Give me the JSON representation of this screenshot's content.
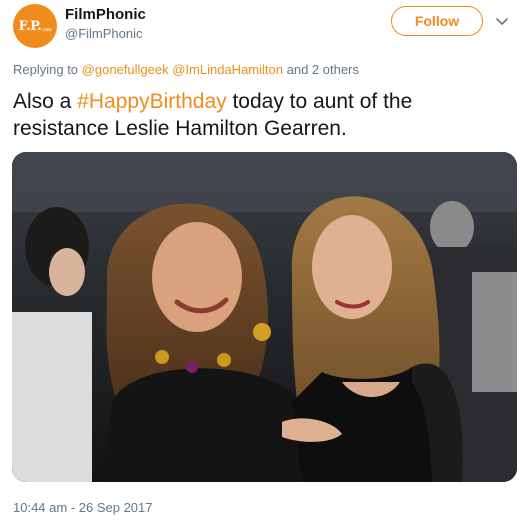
{
  "account": {
    "avatar_text": "F.P.",
    "avatar_sub": "com",
    "name": "FilmPhonic",
    "handle": "@FilmPhonic"
  },
  "actions": {
    "follow_label": "Follow",
    "menu_icon": "chevron-down-icon"
  },
  "reply": {
    "prefix": "Replying to",
    "mention1": "@gonefullgeek",
    "mention2": "@ImLindaHamilton",
    "suffix": "and 2 others"
  },
  "tweet": {
    "text_before": "Also a ",
    "hashtag": "#HappyBirthday",
    "text_after": " today to aunt of the resistance Leslie Hamilton Gearren."
  },
  "timestamp": "10:44 am - 26 Sep 2017",
  "colors": {
    "accent": "#f08c1c",
    "muted": "#657786",
    "text": "#14171a"
  }
}
